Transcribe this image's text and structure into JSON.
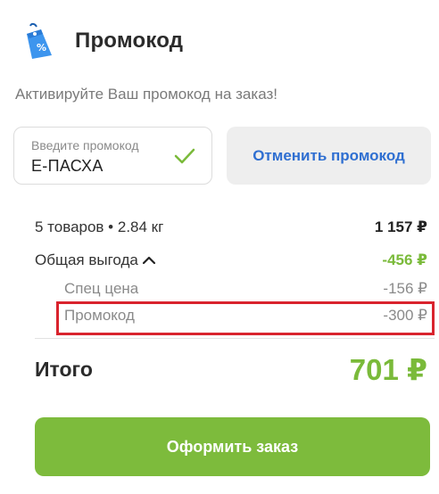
{
  "header": {
    "title": "Промокод",
    "icon": "discount-tag-icon",
    "icon_color": "#2f88e6"
  },
  "subtitle": "Активируйте Ваш промокод на заказ!",
  "promo_field": {
    "label": "Введите промокод",
    "value": "Е-ПАСХА",
    "status_icon": "check-icon",
    "status_color": "#7aba3a"
  },
  "cancel_button": {
    "label": "Отменить промокод",
    "color": "#2f6fd1"
  },
  "summary": {
    "items": {
      "label": "5 товаров • 2.84 кг",
      "amount": "1 157 ₽"
    },
    "benefit": {
      "label": "Общая выгода",
      "amount": "-456 ₽",
      "icon": "chevron-up-icon"
    },
    "special_price": {
      "label": "Спец цена",
      "amount": "-156 ₽"
    },
    "promo": {
      "label": "Промокод",
      "amount": "-300 ₽"
    }
  },
  "total": {
    "label": "Итого",
    "amount": "701 ₽"
  },
  "order_button": {
    "label": "Оформить заказ",
    "color": "#7dbb3c"
  },
  "highlight_color": "#d9232d"
}
